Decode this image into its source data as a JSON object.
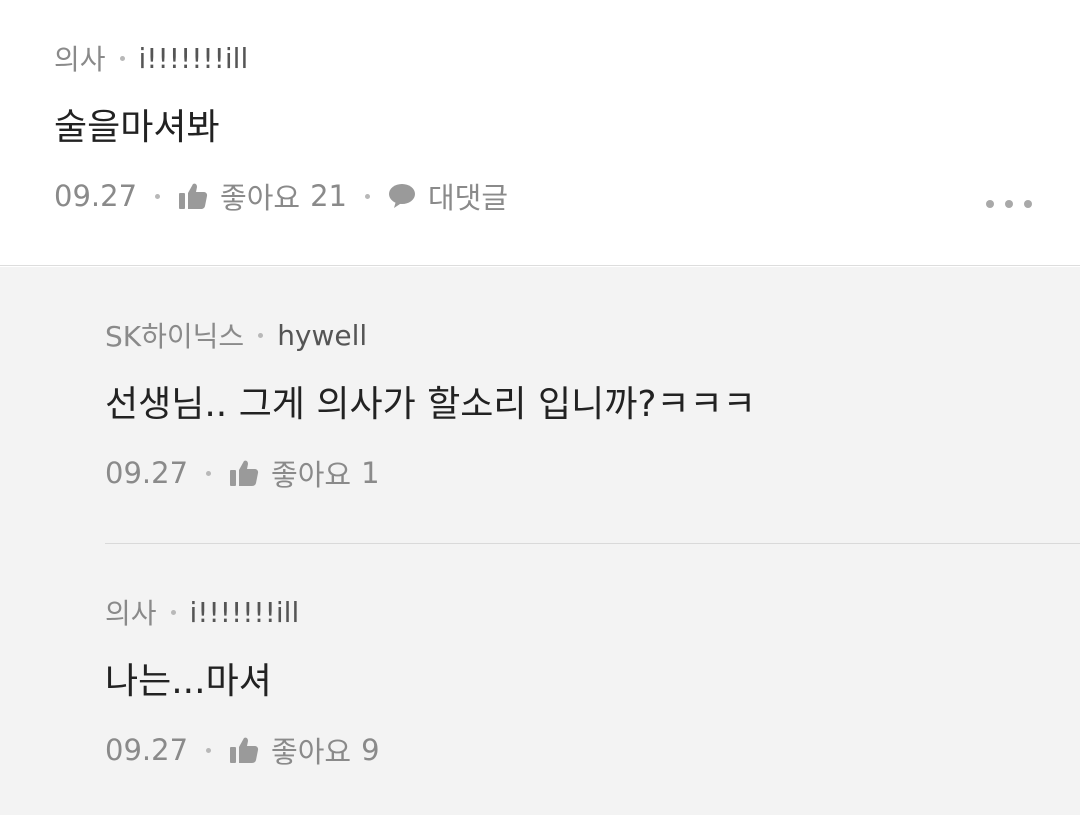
{
  "comment": {
    "author_name": "의사",
    "author_id": "i!!!!!!!ill",
    "text": "술을마셔봐",
    "date": "09.27",
    "like_label": "좋아요",
    "like_count": "21",
    "reply_label": "대댓글"
  },
  "replies": [
    {
      "author_name": "SK하이닉스",
      "author_id": "hywell",
      "text": "선생님.. 그게 의사가 할소리 입니까?ㅋㅋㅋ",
      "date": "09.27",
      "like_label": "좋아요",
      "like_count": "1"
    },
    {
      "author_name": "의사",
      "author_id": "i!!!!!!!ill",
      "text": "나는...마셔",
      "date": "09.27",
      "like_label": "좋아요",
      "like_count": "9"
    }
  ],
  "colors": {
    "text_primary": "#222222",
    "text_secondary": "#8a8a8a",
    "reply_background": "#f3f3f3"
  },
  "icons": {
    "like": "thumbs-up-icon",
    "reply": "speech-bubble-icon",
    "more": "more-dots-icon"
  }
}
